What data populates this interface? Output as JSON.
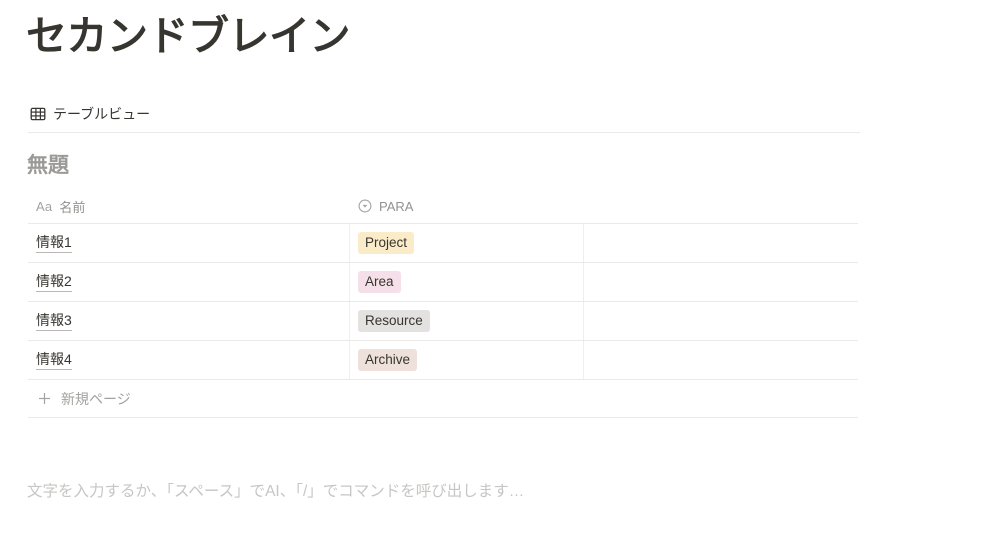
{
  "page": {
    "title": "セカンドブレイン"
  },
  "view_bar": {
    "tabs": [
      {
        "label": "テーブルビュー",
        "icon": "table-grid-icon"
      }
    ]
  },
  "database": {
    "title": "無題",
    "columns": [
      {
        "key": "name",
        "label": "名前",
        "icon": "title-text-icon",
        "icon_glyph": "Aa"
      },
      {
        "key": "para",
        "label": "PARA",
        "icon": "select-circle-chevron-icon"
      },
      {
        "key": "blank",
        "label": "",
        "icon": ""
      }
    ],
    "rows": [
      {
        "name": "情報1",
        "para": "Project",
        "para_bg": "#fbecc9",
        "para_fg": "#37352f"
      },
      {
        "name": "情報2",
        "para": "Area",
        "para_bg": "#f5e0e9",
        "para_fg": "#37352f"
      },
      {
        "name": "情報3",
        "para": "Resource",
        "para_bg": "#e3e2e0",
        "para_fg": "#37352f"
      },
      {
        "name": "情報4",
        "para": "Archive",
        "para_bg": "#eee0da",
        "para_fg": "#37352f"
      }
    ],
    "new_row_label": "新規ページ"
  },
  "body": {
    "placeholder": "文字を入力するか、「スペース」でAI、「/」でコマンドを呼び出します…"
  },
  "colors": {
    "text": "#37352f",
    "muted": "#9b9a97",
    "placeholder": "#c7c6c4",
    "border": "#e9e9e7",
    "background": "#ffffff"
  }
}
